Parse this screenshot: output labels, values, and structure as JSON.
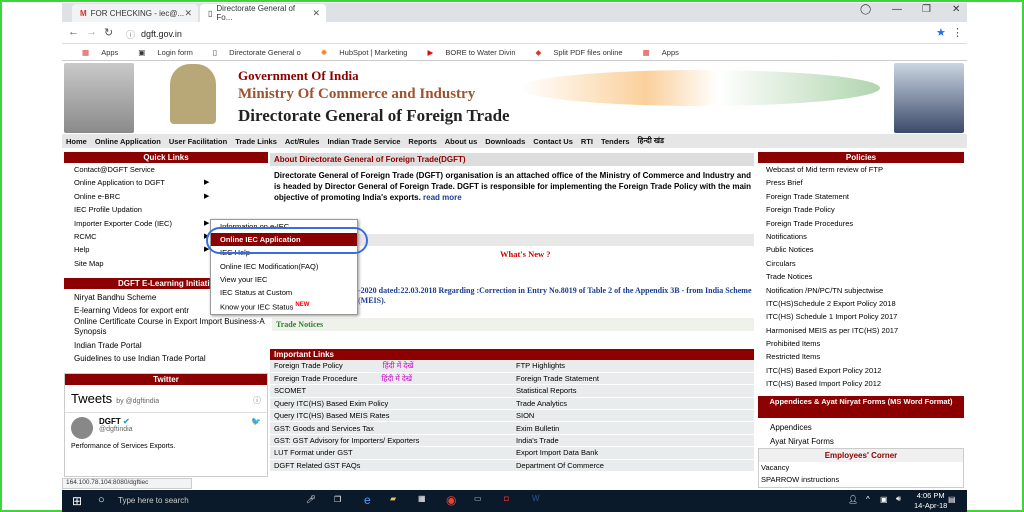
{
  "browser": {
    "tabs": [
      "FOR CHECKING - iec@...",
      "Directorate General of Fo..."
    ],
    "url": "dgft.gov.in",
    "bookmarks": [
      "Apps",
      "Login form",
      "Directorate General o",
      "HubSpot | Marketing",
      "BORE to Water Divin",
      "Split PDF files online",
      "Apps"
    ]
  },
  "header": {
    "line1": "Government Of India",
    "line2": "Ministry Of Commerce and Industry",
    "line3": "Directorate General of Foreign Trade"
  },
  "nav": [
    "Home",
    "Online Application",
    "User Facilitation",
    "Trade Links",
    "Act/Rules",
    "Indian Trade Service",
    "Reports",
    "About us",
    "Downloads",
    "Contact Us",
    "RTI",
    "Tenders",
    "हिन्दी खंड"
  ],
  "quick_links": {
    "title": "Quick Links",
    "items": [
      "Contact@DGFT Service",
      "Online Application to DGFT",
      "Online e-BRC",
      "IEC Profile Updation",
      "Importer Exporter Code (IEC)",
      "RCMC",
      "Help",
      "Site Map"
    ]
  },
  "elearning": {
    "title": "DGFT E-Learning Initiativ",
    "items": [
      "Niryat Bandhu Scheme",
      "E-learning Videos for export entr",
      "Online Certificate Course in Export Import Business-A Synopsis",
      "Indian Trade Portal",
      "Guidelines to use Indian Trade Portal"
    ]
  },
  "twitter": {
    "title": "Twitter",
    "tweets_label": "Tweets",
    "by": "by @dgftindia",
    "user": "DGFT",
    "handle": "@dgftindia",
    "text": "Performance of Services Exports."
  },
  "about": {
    "title": "About Directorate General of Foreign Trade(DGFT)",
    "body": "Directorate General of Foreign Trade (DGFT) organisation is an attached office of the Ministry of Commerce and Industry and is headed by Director General of Foreign Trade. DGFT is responsible for implementing the Foreign Trade Policy with the main objective of promoting India's exports.",
    "more": "read more"
  },
  "whats_new": "What's New ?",
  "news1": "-2020 dated:22.03.2018 Regarding :Correction in Entry No.8019 of Table 2 of the Appendix 3B - from India Scheme (MEIS).",
  "trade_notices": "Trade Notices",
  "popup": {
    "items": [
      "Information on e-IEC",
      "Online IEC Application",
      "IEC Help",
      "Online IEC Modification(FAQ)",
      "View your IEC",
      "IEC Status at Custom",
      "Know your IEC Status"
    ],
    "new_badge": "NEW"
  },
  "important_links": {
    "title": "Important Links",
    "hindi_label": "हिंदी में देखें",
    "rows": [
      [
        "Foreign Trade Policy",
        "FTP Highlights"
      ],
      [
        "Foreign Trade Procedure",
        "Foreign Trade Statement"
      ],
      [
        "SCOMET",
        "Statistical Reports"
      ],
      [
        "Query ITC(HS) Based Exim Policy",
        "Trade Analytics"
      ],
      [
        "Query ITC(HS) Based MEIS Rates",
        "SION"
      ],
      [
        "GST: Goods and Services Tax",
        "Exim Bulletin"
      ],
      [
        "GST: GST Advisory for Importers/ Exporters",
        "India's Trade"
      ],
      [
        "LUT Format under GST",
        "Export Import Data Bank"
      ],
      [
        "DGFT Related GST FAQs",
        "Department Of Commerce"
      ]
    ]
  },
  "policies": {
    "title": "Policies",
    "items": [
      "Webcast of Mid term review of FTP",
      "Press Brief",
      "Foreign Trade Statement",
      "Foreign Trade Policy",
      "Foreign Trade Procedures",
      "Notifications",
      "Public Notices",
      "Circulars",
      "Trade Notices",
      "Notification /PN/PC/TN subjectwise",
      "ITC(HS)Schedule 2 Export Policy 2018",
      "ITC(HS) Schedule 1 Import Policy 2017",
      "Harmonised MEIS as per ITC(HS) 2017",
      "Prohibited Items",
      "Restricted Items",
      "ITC(HS) Based Export Policy 2012",
      "ITC(HS) Based Import Policy 2012"
    ]
  },
  "appendices": {
    "title": "Appendices & Ayat Niryat Forms (MS Word Format)",
    "items": [
      "Appendices",
      "Ayat Niryat Forms"
    ]
  },
  "employees": {
    "title": "Employees' Corner",
    "items": [
      "Vacancy",
      "SPARROW instructions"
    ]
  },
  "status_url": "164.100.78.104:8080/dgftiec",
  "taskbar": {
    "search": "Type here to search",
    "time": "4:06 PM",
    "date": "14-Apr-18"
  }
}
